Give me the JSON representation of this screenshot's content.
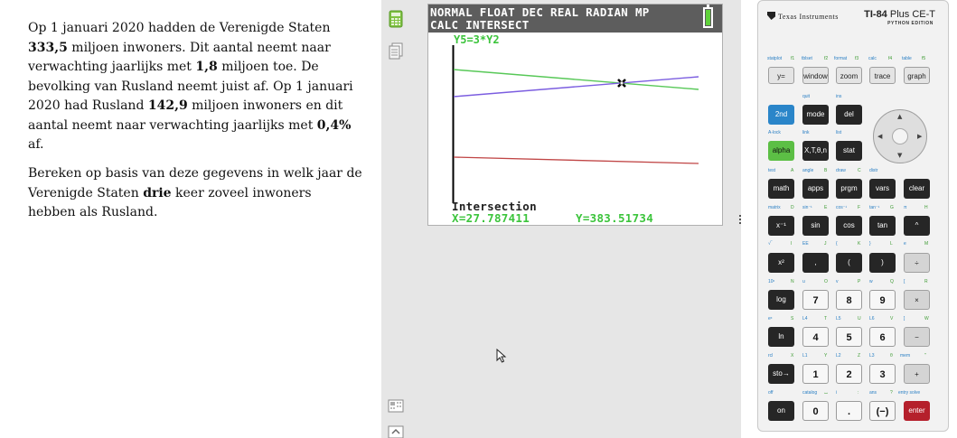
{
  "question": {
    "p1_a": "Op 1 januari 2020 hadden de Verenigde Staten ",
    "p1_b1": "333,5",
    "p1_c": " miljoen inwoners. Dit aantal neemt naar verwachting jaarlijks met ",
    "p1_b2": "1,8",
    "p1_d": " miljoen toe. De bevolking van Rusland neemt juist af. Op 1 januari 2020 had Rusland ",
    "p1_b3": "142,9",
    "p1_e": " miljoen inwoners en dit aantal neemt naar verwachting jaarlijks met ",
    "p1_b4": "0,4%",
    "p1_f": " af.",
    "p2_a": "Bereken op basis van deze gegevens in welk jaar de Verenigde Staten ",
    "p2_b": "drie",
    "p2_c": " keer zoveel inwoners hebben als Rusland."
  },
  "screen": {
    "status_line1": "NORMAL FLOAT DEC REAL RADIAN MP",
    "status_line2": "CALC INTERSECT",
    "function_label": "Y5=3*Y2",
    "intersection_label": "Intersection",
    "x_readout": "X=27.787411",
    "y_readout": "Y=383.51734",
    "line_colors": {
      "green": "#57c857",
      "purple": "#7b5de0",
      "red": "#c04545"
    }
  },
  "calculator": {
    "brand": "Texas Instruments",
    "model": "TI-84",
    "model_suffix": "Plus CE-T",
    "edition": "PYTHON EDITION",
    "keys": {
      "y_eq": "y=",
      "window": "window",
      "zoom": "zoom",
      "trace": "trace",
      "graph": "graph",
      "second": "2nd",
      "mode": "mode",
      "del": "del",
      "alpha": "alpha",
      "xton": "X,T,θ,n",
      "stat": "stat",
      "math": "math",
      "apps": "apps",
      "prgm": "prgm",
      "vars": "vars",
      "clear": "clear",
      "inv": "x⁻¹",
      "sin": "sin",
      "cos": "cos",
      "tan": "tan",
      "caret": "^",
      "sq": "x²",
      "comma": ",",
      "lpar": "(",
      "rpar": ")",
      "div": "÷",
      "log": "log",
      "k7": "7",
      "k8": "8",
      "k9": "9",
      "mul": "×",
      "ln": "ln",
      "k4": "4",
      "k5": "5",
      "k6": "6",
      "sub": "−",
      "sto": "sto→",
      "k1": "1",
      "k2": "2",
      "k3": "3",
      "add": "+",
      "on": "on",
      "k0": "0",
      "dot": ".",
      "neg": "(−)",
      "enter": "enter"
    },
    "labels": {
      "statplot": "statplot",
      "f1": "f1",
      "tblset": "tblset",
      "f2": "f2",
      "format": "format",
      "f3": "f3",
      "calc": "calc",
      "f4": "f4",
      "table": "table",
      "f5": "f5",
      "quit": "quit",
      "ins": "ins",
      "alock": "A-lock",
      "link": "link",
      "list": "list",
      "test": "test",
      "a": "A",
      "angle": "angle",
      "b": "B",
      "draw": "draw",
      "c": "C",
      "distr": "distr",
      "matrix": "matrix",
      "d": "D",
      "asin": "sin⁻¹",
      "e": "E",
      "acos": "cos⁻¹",
      "f": "F",
      "atan": "tan⁻¹",
      "g": "G",
      "pi": "π",
      "h": "H",
      "sqrt": "√‾",
      "i": "I",
      "ee": "EE",
      "j": "J",
      "lbrace": "{",
      "kk": "K",
      "rbrace": "}",
      "l": "L",
      "ee2": "e",
      "m": "M",
      "tenx": "10ˣ",
      "n": "N",
      "u": "u",
      "o": "O",
      "v": "v",
      "p": "P",
      "w": "w",
      "q": "Q",
      "lbr": "[",
      "r": "R",
      "ex": "eˣ",
      "s": "S",
      "l4": "L4",
      "t": "T",
      "l5": "L5",
      "uu": "U",
      "l6": "L6",
      "vv": "V",
      "rbr": "]",
      "ww": "W",
      "rcl": "rcl",
      "x": "X",
      "l1": "L1",
      "y": "Y",
      "l2": "L2",
      "z": "Z",
      "l3": "L3",
      "theta": "θ",
      "mem": "mem",
      "quote": "\"",
      "off": "off",
      "catalog": "catalog",
      "space": "⌴",
      "slash": "i",
      "colon": ":",
      "ans": "ans",
      "question": "?",
      "entry": "entry solve"
    }
  }
}
